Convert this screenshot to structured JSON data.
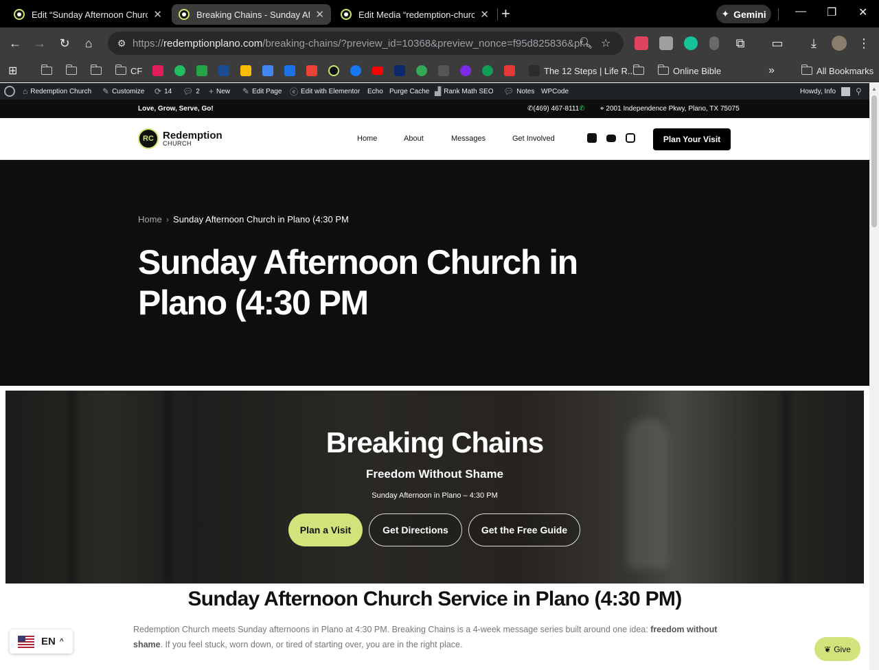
{
  "browser": {
    "tabs": [
      {
        "title": "Edit “Sunday Afternoon Church",
        "active": false
      },
      {
        "title": "Breaking Chains - Sunday Aftern",
        "active": true
      },
      {
        "title": "Edit Media “redemption-church",
        "active": false
      }
    ],
    "new_tab": "+",
    "gemini_label": "Gemini",
    "url_scheme": "https://",
    "url_host": "redemptionplano.com",
    "url_path": "/breaking-chains/?preview_id=10368&preview_nonce=f95d825836&pr...",
    "bookmarks": {
      "cf": "CF",
      "twelve_steps": "The 12 Steps | Life R...",
      "online_bible": "Online Bible",
      "overflow": "»",
      "all": "All Bookmarks"
    }
  },
  "wp_admin": {
    "site_name": "Redemption Church",
    "customize": "Customize",
    "updates": "14",
    "comments": "2",
    "new": "New",
    "edit_page": "Edit Page",
    "elementor": "Edit with Elementor",
    "echo": "Echo",
    "purge": "Purge Cache",
    "rankmath": "Rank Math SEO",
    "notes": "Notes",
    "wpcode": "WPCode",
    "howdy": "Howdy, Info"
  },
  "site": {
    "topbar": {
      "tagline": "Love, Grow, Serve, Go!",
      "phone": "(469) 467-8111",
      "address": "2001 Independence Pkwy, Plano, TX 75075"
    },
    "logo": {
      "mark": "RC",
      "name": "Redemption",
      "sub": "CHURCH"
    },
    "nav": [
      "Home",
      "About",
      "Messages",
      "Get Involved"
    ],
    "plan_visit": "Plan Your Visit",
    "hero": {
      "crumb_home": "Home",
      "crumb_sep": "›",
      "crumb_current": "Sunday Afternoon Church in Plano (4:30 PM",
      "title": "Sunday Afternoon Church in Plano (4:30 PM"
    },
    "banner": {
      "title": "Breaking Chains",
      "subtitle": "Freedom Without Shame",
      "time": "Sunday Afternoon in Plano – 4:30 PM",
      "btn_plan": "Plan a Visit",
      "btn_directions": "Get Directions",
      "btn_guide": "Get the Free Guide"
    },
    "section": {
      "heading": "Sunday Afternoon Church Service in Plano (4:30 PM)",
      "p1": "Redemption Church meets Sunday afternoons in Plano at 4:30 PM. Breaking Chains is a 4-week message series built around one idea: ",
      "p_bold": "freedom without shame",
      "p2": ". If you feel stuck, worn down, or tired of starting over, you are in the right place."
    },
    "lang": "EN",
    "give": "Give"
  },
  "colors": {
    "accent_green": "#d4e27b",
    "hero_bg": "#0e0e0e",
    "wp_bar": "#1d2327"
  }
}
